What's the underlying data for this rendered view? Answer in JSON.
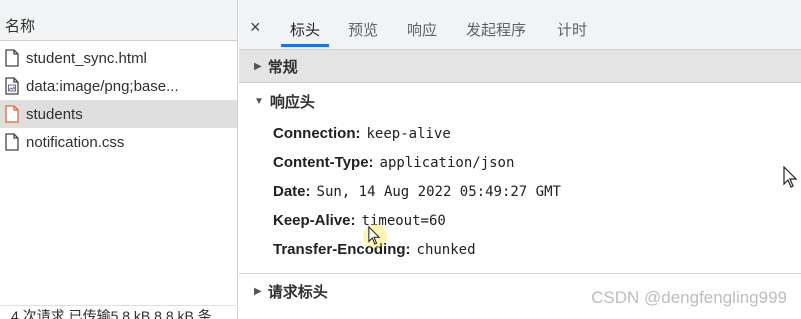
{
  "request_list": {
    "header": "名称",
    "items": [
      {
        "name": "student_sync.html",
        "icon": "document-icon",
        "selected": false
      },
      {
        "name": "data:image/png;base...",
        "icon": "image-file-icon",
        "selected": false
      },
      {
        "name": "students",
        "icon": "document-icon",
        "selected": true,
        "icon_color": "#e8603c"
      },
      {
        "name": "notification.css",
        "icon": "document-icon",
        "selected": false
      }
    ],
    "status_text": "4 次请求  已传输5.8 kB  8.8 kB 条"
  },
  "detail": {
    "close_symbol": "×",
    "tabs": [
      {
        "label": "标头",
        "active": true
      },
      {
        "label": "预览",
        "active": false
      },
      {
        "label": "响应",
        "active": false
      },
      {
        "label": "发起程序",
        "active": false
      },
      {
        "label": "计时",
        "active": false
      }
    ],
    "general_section": "常规",
    "response_headers_section": "响应头",
    "response_headers": [
      {
        "name": "Connection:",
        "value": "keep-alive"
      },
      {
        "name": "Content-Type:",
        "value": "application/json"
      },
      {
        "name": "Date:",
        "value": "Sun, 14 Aug 2022 05:49:27 GMT"
      },
      {
        "name": "Keep-Alive:",
        "value": "timeout=60"
      },
      {
        "name": "Transfer-Encoding:",
        "value": "chunked"
      }
    ],
    "request_headers_section": "请求标头"
  },
  "watermark": "CSDN @dengfengling999",
  "colors": {
    "accent": "#1a73e8",
    "selected_row": "#dedede",
    "highlight": "#e8603c"
  }
}
